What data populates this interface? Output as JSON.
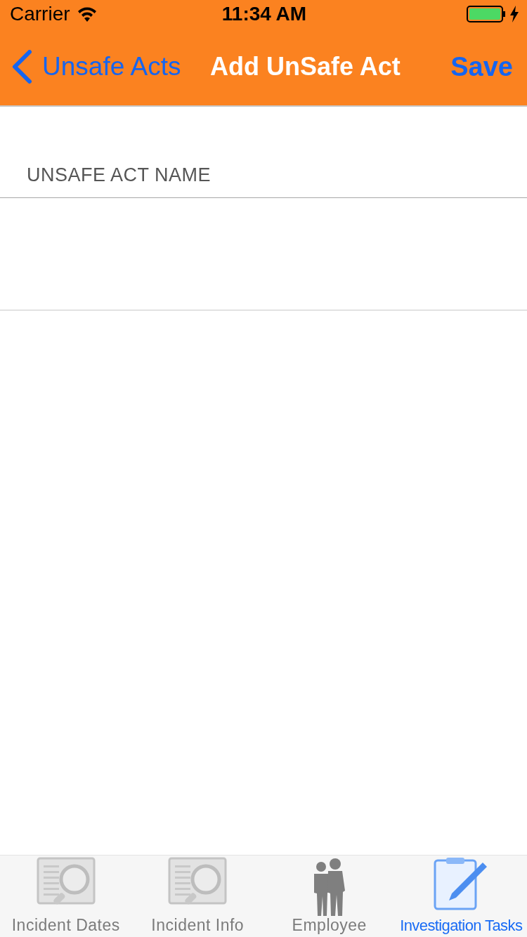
{
  "status_bar": {
    "carrier": "Carrier",
    "time": "11:34 AM"
  },
  "nav_bar": {
    "back": "Unsafe Acts",
    "title": "Add UnSafe Act",
    "action": "Save"
  },
  "section": {
    "header": "UNSAFE ACT NAME"
  },
  "tabs": [
    {
      "label": "Incident Dates",
      "kind": "document",
      "selected": false
    },
    {
      "label": "Incident Info",
      "kind": "document",
      "selected": false
    },
    {
      "label": "Employee",
      "kind": "people",
      "selected": false
    },
    {
      "label": "Investigation Tasks",
      "kind": "clipboard",
      "selected": true
    }
  ]
}
